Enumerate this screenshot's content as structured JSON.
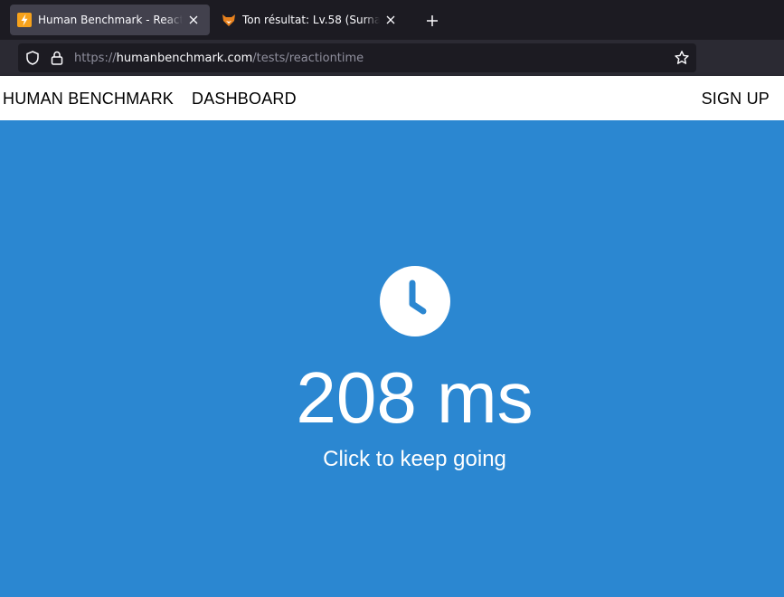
{
  "browser": {
    "tabs": [
      {
        "title": "Human Benchmark - Reaction Time Test",
        "favicon": "lightning-icon",
        "active": true
      },
      {
        "title": "Ton résultat: Lv.58 (Surnaturel)!",
        "favicon": "fox-icon",
        "active": false
      }
    ],
    "url": {
      "scheme": "https://",
      "host": "humanbenchmark.com",
      "path": "/tests/reactiontime"
    }
  },
  "site": {
    "nav": {
      "home": "HUMAN BENCHMARK",
      "dashboard": "DASHBOARD",
      "signup": "SIGN UP"
    }
  },
  "test": {
    "icon": "clock-icon",
    "result": "208 ms",
    "prompt": "Click to keep going"
  },
  "colors": {
    "background": "#2b87d1",
    "tab_active": "#42414d",
    "tabbar": "#1c1b22"
  }
}
